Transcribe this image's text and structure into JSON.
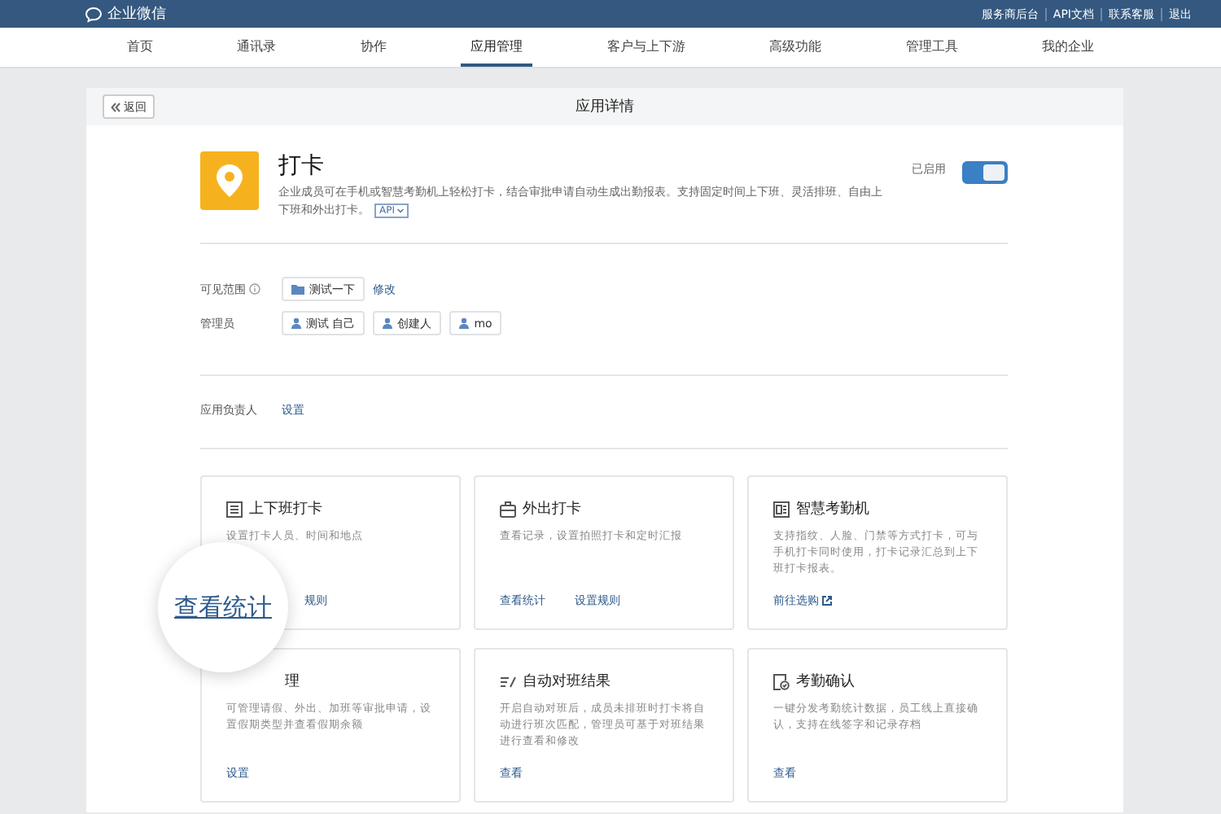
{
  "topbar": {
    "logo": "企业微信",
    "links": [
      "服务商后台",
      "API文档",
      "联系客服",
      "退出"
    ]
  },
  "nav": [
    {
      "label": "首页",
      "selected": false
    },
    {
      "label": "通讯录",
      "selected": false
    },
    {
      "label": "协作",
      "selected": false
    },
    {
      "label": "应用管理",
      "selected": true
    },
    {
      "label": "客户与上下游",
      "selected": false
    },
    {
      "label": "高级功能",
      "selected": false
    },
    {
      "label": "管理工具",
      "selected": false
    },
    {
      "label": "我的企业",
      "selected": false
    }
  ],
  "panel": {
    "back": "返回",
    "title": "应用详情"
  },
  "app": {
    "name": "打卡",
    "description": "企业成员可在手机或智慧考勤机上轻松打卡，结合审批申请自动生成出勤报表。支持固定时间上下班、灵活排班、自由上下班和外出打卡。",
    "api_badge": "API",
    "status_label": "已启用",
    "enabled": true
  },
  "visibility": {
    "label": "可见范围",
    "tags": [
      "测试一下"
    ],
    "action": "修改"
  },
  "admins": {
    "label": "管理员",
    "tags": [
      "测试 自己",
      "创建人",
      "mo"
    ]
  },
  "owner": {
    "label": "应用负责人",
    "action": "设置"
  },
  "cards": [
    {
      "kind": "list",
      "title": "上下班打卡",
      "description": "设置打卡人员、时间和地点",
      "magnifier_link": "查看统计",
      "links": [
        {
          "label": "规则",
          "external": false
        }
      ]
    },
    {
      "kind": "briefcase",
      "title": "外出打卡",
      "description": "查看记录，设置拍照打卡和定时汇报",
      "links": [
        {
          "label": "查看统计",
          "external": false
        },
        {
          "label": "设置规则",
          "external": false
        }
      ]
    },
    {
      "kind": "device",
      "title": "智慧考勤机",
      "description": "支持指纹、人脸、门禁等方式打卡，可与手机打卡同时使用，打卡记录汇总到上下班打卡报表。",
      "links": [
        {
          "label": "前往选购",
          "external": true
        }
      ]
    },
    {
      "kind": "covered",
      "title": "理",
      "description": "可管理请假、外出、加班等审批申请，设置假期类型并查看假期余额",
      "links": [
        {
          "label": "设置",
          "external": false
        }
      ]
    },
    {
      "kind": "lines",
      "title": "自动对班结果",
      "description": "开启自动对班后，成员未排班时打卡将自动进行班次匹配，管理员可基于对班结果进行查看和修改",
      "links": [
        {
          "label": "查看",
          "external": false
        }
      ]
    },
    {
      "kind": "doc",
      "title": "考勤确认",
      "description": "一键分发考勤统计数据，员工线上直接确认，支持在线签字和记录存档",
      "links": [
        {
          "label": "查看",
          "external": false
        }
      ]
    }
  ]
}
